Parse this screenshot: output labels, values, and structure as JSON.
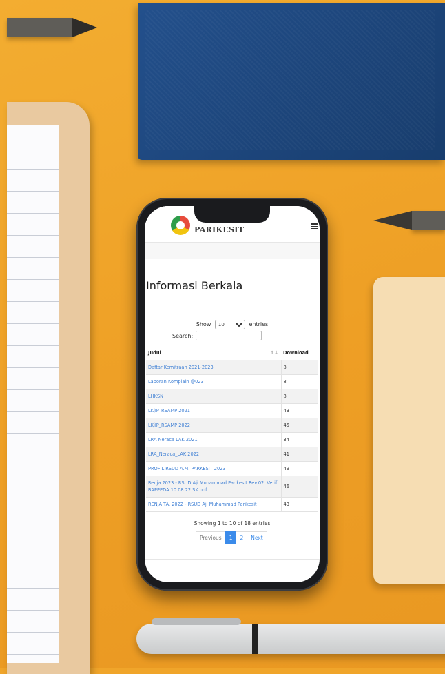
{
  "site": {
    "logo_text": "PARIKESIT",
    "colors": {
      "link": "#3e7fd4",
      "pager_active": "#3b8bea"
    }
  },
  "page": {
    "title": "Informasi Berkala"
  },
  "table_controls": {
    "show_label": "Show",
    "length_value": "10",
    "entries_label": "entries",
    "search_label": "Search:",
    "search_value": ""
  },
  "table": {
    "headers": [
      "Judul",
      "Download"
    ],
    "rows": [
      {
        "title": "Daftar Kemitraan 2021-2023",
        "download": "8"
      },
      {
        "title": "Laporan Komplain @023",
        "download": "8"
      },
      {
        "title": "LHKSN",
        "download": "8"
      },
      {
        "title": "LKjIP_RSAMP 2021",
        "download": "43"
      },
      {
        "title": "LKjIP_RSAMP 2022",
        "download": "45"
      },
      {
        "title": "LRA Neraca LAK 2021",
        "download": "34"
      },
      {
        "title": "LRA_Neraca_LAK 2022",
        "download": "41"
      },
      {
        "title": "PROFIL RSUD A.M. PARKESIT 2023",
        "download": "49"
      },
      {
        "title": "Renja 2023 - RSUD Aji Muhammad Parikesit Rev.02. Verif BAPPEDA 10.08.22 SK pdf",
        "download": "46"
      },
      {
        "title": "RENJA TA. 2022 - RSUD Aji Muhammad Parikesit",
        "download": "43"
      }
    ]
  },
  "pagination": {
    "info": "Showing 1 to 10 of 18 entries",
    "previous": "Previous",
    "pages": [
      "1",
      "2"
    ],
    "next": "Next"
  }
}
